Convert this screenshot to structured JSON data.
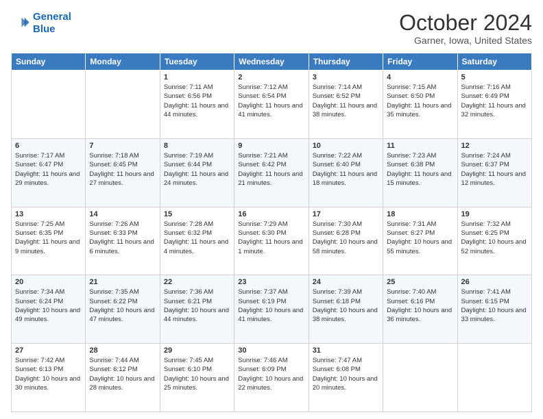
{
  "header": {
    "logo_line1": "General",
    "logo_line2": "Blue",
    "month": "October 2024",
    "location": "Garner, Iowa, United States"
  },
  "days_of_week": [
    "Sunday",
    "Monday",
    "Tuesday",
    "Wednesday",
    "Thursday",
    "Friday",
    "Saturday"
  ],
  "weeks": [
    [
      {
        "day": "",
        "info": ""
      },
      {
        "day": "",
        "info": ""
      },
      {
        "day": "1",
        "info": "Sunrise: 7:11 AM\nSunset: 6:56 PM\nDaylight: 11 hours and 44 minutes."
      },
      {
        "day": "2",
        "info": "Sunrise: 7:12 AM\nSunset: 6:54 PM\nDaylight: 11 hours and 41 minutes."
      },
      {
        "day": "3",
        "info": "Sunrise: 7:14 AM\nSunset: 6:52 PM\nDaylight: 11 hours and 38 minutes."
      },
      {
        "day": "4",
        "info": "Sunrise: 7:15 AM\nSunset: 6:50 PM\nDaylight: 11 hours and 35 minutes."
      },
      {
        "day": "5",
        "info": "Sunrise: 7:16 AM\nSunset: 6:49 PM\nDaylight: 11 hours and 32 minutes."
      }
    ],
    [
      {
        "day": "6",
        "info": "Sunrise: 7:17 AM\nSunset: 6:47 PM\nDaylight: 11 hours and 29 minutes."
      },
      {
        "day": "7",
        "info": "Sunrise: 7:18 AM\nSunset: 6:45 PM\nDaylight: 11 hours and 27 minutes."
      },
      {
        "day": "8",
        "info": "Sunrise: 7:19 AM\nSunset: 6:44 PM\nDaylight: 11 hours and 24 minutes."
      },
      {
        "day": "9",
        "info": "Sunrise: 7:21 AM\nSunset: 6:42 PM\nDaylight: 11 hours and 21 minutes."
      },
      {
        "day": "10",
        "info": "Sunrise: 7:22 AM\nSunset: 6:40 PM\nDaylight: 11 hours and 18 minutes."
      },
      {
        "day": "11",
        "info": "Sunrise: 7:23 AM\nSunset: 6:38 PM\nDaylight: 11 hours and 15 minutes."
      },
      {
        "day": "12",
        "info": "Sunrise: 7:24 AM\nSunset: 6:37 PM\nDaylight: 11 hours and 12 minutes."
      }
    ],
    [
      {
        "day": "13",
        "info": "Sunrise: 7:25 AM\nSunset: 6:35 PM\nDaylight: 11 hours and 9 minutes."
      },
      {
        "day": "14",
        "info": "Sunrise: 7:26 AM\nSunset: 6:33 PM\nDaylight: 11 hours and 6 minutes."
      },
      {
        "day": "15",
        "info": "Sunrise: 7:28 AM\nSunset: 6:32 PM\nDaylight: 11 hours and 4 minutes."
      },
      {
        "day": "16",
        "info": "Sunrise: 7:29 AM\nSunset: 6:30 PM\nDaylight: 11 hours and 1 minute."
      },
      {
        "day": "17",
        "info": "Sunrise: 7:30 AM\nSunset: 6:28 PM\nDaylight: 10 hours and 58 minutes."
      },
      {
        "day": "18",
        "info": "Sunrise: 7:31 AM\nSunset: 6:27 PM\nDaylight: 10 hours and 55 minutes."
      },
      {
        "day": "19",
        "info": "Sunrise: 7:32 AM\nSunset: 6:25 PM\nDaylight: 10 hours and 52 minutes."
      }
    ],
    [
      {
        "day": "20",
        "info": "Sunrise: 7:34 AM\nSunset: 6:24 PM\nDaylight: 10 hours and 49 minutes."
      },
      {
        "day": "21",
        "info": "Sunrise: 7:35 AM\nSunset: 6:22 PM\nDaylight: 10 hours and 47 minutes."
      },
      {
        "day": "22",
        "info": "Sunrise: 7:36 AM\nSunset: 6:21 PM\nDaylight: 10 hours and 44 minutes."
      },
      {
        "day": "23",
        "info": "Sunrise: 7:37 AM\nSunset: 6:19 PM\nDaylight: 10 hours and 41 minutes."
      },
      {
        "day": "24",
        "info": "Sunrise: 7:39 AM\nSunset: 6:18 PM\nDaylight: 10 hours and 38 minutes."
      },
      {
        "day": "25",
        "info": "Sunrise: 7:40 AM\nSunset: 6:16 PM\nDaylight: 10 hours and 36 minutes."
      },
      {
        "day": "26",
        "info": "Sunrise: 7:41 AM\nSunset: 6:15 PM\nDaylight: 10 hours and 33 minutes."
      }
    ],
    [
      {
        "day": "27",
        "info": "Sunrise: 7:42 AM\nSunset: 6:13 PM\nDaylight: 10 hours and 30 minutes."
      },
      {
        "day": "28",
        "info": "Sunrise: 7:44 AM\nSunset: 6:12 PM\nDaylight: 10 hours and 28 minutes."
      },
      {
        "day": "29",
        "info": "Sunrise: 7:45 AM\nSunset: 6:10 PM\nDaylight: 10 hours and 25 minutes."
      },
      {
        "day": "30",
        "info": "Sunrise: 7:46 AM\nSunset: 6:09 PM\nDaylight: 10 hours and 22 minutes."
      },
      {
        "day": "31",
        "info": "Sunrise: 7:47 AM\nSunset: 6:08 PM\nDaylight: 10 hours and 20 minutes."
      },
      {
        "day": "",
        "info": ""
      },
      {
        "day": "",
        "info": ""
      }
    ]
  ]
}
